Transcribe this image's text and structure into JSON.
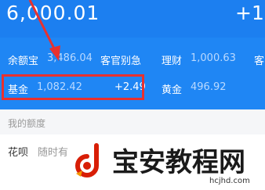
{
  "header": {
    "balance": "6,000.01",
    "right_value": "+1"
  },
  "assets": {
    "yuebao_label": "余额宝",
    "yuebao_value": "3,486.04",
    "yuebao_note": "客官别急",
    "licai_label": "理财",
    "licai_value": "1,000.63",
    "licai_note": "客",
    "fund_label": "基金",
    "fund_value": "1,082.42",
    "fund_change": "+2.49",
    "gold_label": "黄金",
    "gold_value": "496.92"
  },
  "quota": {
    "section_label": "我的额度",
    "huabei_label": "花呗",
    "huabei_sub": "随时有"
  },
  "watermark": {
    "title": "宝安教程网",
    "url": "hcjhd.com"
  },
  "colors": {
    "header_bg": "#1c7ff0",
    "highlight": "#e8312f"
  }
}
